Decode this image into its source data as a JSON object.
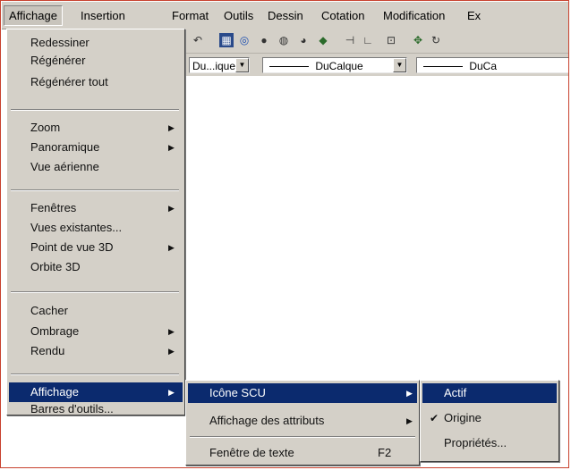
{
  "menubar": [
    {
      "label": "Affichage",
      "open": true
    },
    {
      "label": "Insertion"
    },
    {
      "label": "Format"
    },
    {
      "label": "Outils"
    },
    {
      "label": "Dessin"
    },
    {
      "label": "Cotation"
    },
    {
      "label": "Modification"
    },
    {
      "label": "Ex"
    }
  ],
  "toolbar": {
    "icons": [
      "undo-arrow-icon",
      "properties-icon",
      "object-snap-icon",
      "render-sphere-icon",
      "render-scene-icon",
      "materials-icon",
      "lights-icon",
      "dimension-icon",
      "ucs-icon",
      "zoom-window-icon",
      "pan-icon",
      "redraw-icon"
    ],
    "layer_combo": "Du...ique",
    "linetype_combo": "DuCalque",
    "lineweight_combo": "DuCa"
  },
  "affichage_menu": {
    "items": [
      {
        "label": "Redessiner"
      },
      {
        "label": "Régénérer"
      },
      {
        "label": "Régénérer tout"
      },
      {
        "label": "Zoom",
        "submenu": true
      },
      {
        "label": "Panoramique",
        "submenu": true
      },
      {
        "label": "Vue aérienne"
      },
      {
        "label": "Fenêtres",
        "submenu": true
      },
      {
        "label": "Vues existantes..."
      },
      {
        "label": "Point de vue 3D",
        "submenu": true
      },
      {
        "label": "Orbite 3D"
      },
      {
        "label": "Cacher"
      },
      {
        "label": "Ombrage",
        "submenu": true
      },
      {
        "label": "Rendu",
        "submenu": true
      },
      {
        "label": "Affichage",
        "submenu": true,
        "selected": true
      },
      {
        "label": "Barres d'outils..."
      }
    ]
  },
  "affichage_submenu": {
    "items": [
      {
        "label": "Icône SCU",
        "submenu": true,
        "selected": true
      },
      {
        "label": "Affichage des attributs",
        "submenu": true
      },
      {
        "label": "Fenêtre de texte",
        "shortcut": "F2"
      }
    ]
  },
  "icone_scu_submenu": {
    "items": [
      {
        "label": "Actif",
        "selected": true
      },
      {
        "label": "Origine",
        "checked": true
      },
      {
        "label": "Propriétés..."
      }
    ]
  },
  "colors": {
    "menu_face": "#d4d0c8",
    "highlight": "#0b2a6e",
    "frame_border": "#c8412e"
  }
}
